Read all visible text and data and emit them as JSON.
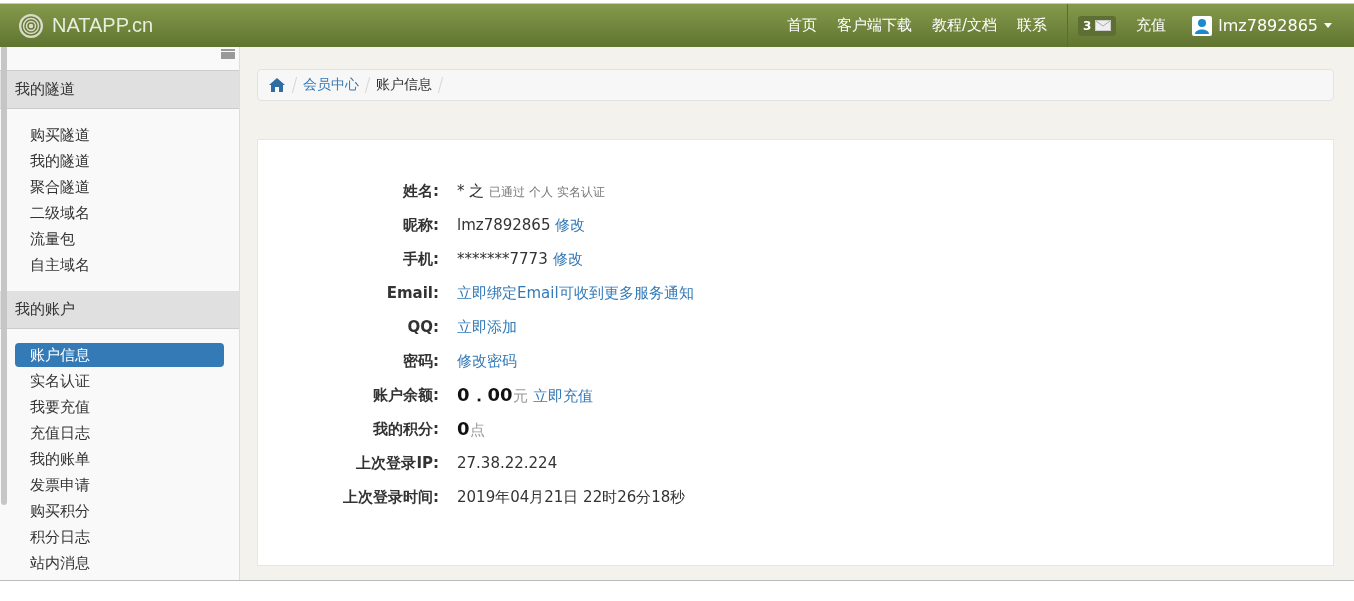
{
  "header": {
    "logo": "NATAPP.cn",
    "nav": [
      "首页",
      "客户端下载",
      "教程/文档",
      "联系"
    ],
    "message_count": "3",
    "recharge": "充值",
    "user": "lmz7892865"
  },
  "sidebar": {
    "sections": [
      {
        "title": "我的隧道",
        "items": [
          {
            "label": "购买隧道",
            "selected": false
          },
          {
            "label": "我的隧道",
            "selected": false
          },
          {
            "label": "聚合隧道",
            "selected": false
          },
          {
            "label": "二级域名",
            "selected": false
          },
          {
            "label": "流量包",
            "selected": false
          },
          {
            "label": "自主域名",
            "selected": false
          }
        ]
      },
      {
        "title": "我的账户",
        "items": [
          {
            "label": "账户信息",
            "selected": true
          },
          {
            "label": "实名认证",
            "selected": false
          },
          {
            "label": "我要充值",
            "selected": false
          },
          {
            "label": "充值日志",
            "selected": false
          },
          {
            "label": "我的账单",
            "selected": false
          },
          {
            "label": "发票申请",
            "selected": false
          },
          {
            "label": "购买积分",
            "selected": false
          },
          {
            "label": "积分日志",
            "selected": false
          },
          {
            "label": "站内消息",
            "selected": false
          }
        ]
      }
    ]
  },
  "breadcrumb": [
    {
      "label": "会员中心",
      "kind": "link"
    },
    {
      "label": "账户信息",
      "kind": "current"
    }
  ],
  "fields": [
    {
      "label": "姓名:",
      "parts": [
        {
          "kind": "text",
          "text": "* 之"
        },
        {
          "kind": "note",
          "text": "已通过 个人 实名认证"
        }
      ]
    },
    {
      "label": "昵称:",
      "parts": [
        {
          "kind": "text",
          "text": "lmz7892865"
        },
        {
          "kind": "link",
          "text": "修改"
        }
      ]
    },
    {
      "label": "手机:",
      "parts": [
        {
          "kind": "text",
          "text": "*******7773"
        },
        {
          "kind": "link",
          "text": "修改"
        }
      ]
    },
    {
      "label": "Email:",
      "parts": [
        {
          "kind": "link",
          "text": "立即绑定Email可收到更多服务通知"
        }
      ]
    },
    {
      "label": "QQ:",
      "parts": [
        {
          "kind": "link",
          "text": "立即添加"
        }
      ]
    },
    {
      "label": "密码:",
      "parts": [
        {
          "kind": "link",
          "text": "修改密码"
        }
      ]
    },
    {
      "label": "账户余额:",
      "parts": [
        {
          "kind": "amount",
          "text": "0．00"
        },
        {
          "kind": "unit",
          "text": "元"
        },
        {
          "kind": "link",
          "text": "立即充值"
        }
      ]
    },
    {
      "label": "我的积分:",
      "parts": [
        {
          "kind": "amount",
          "text": "0"
        },
        {
          "kind": "unit",
          "text": "点"
        }
      ]
    },
    {
      "label": "上次登录IP:",
      "parts": [
        {
          "kind": "text",
          "text": "27.38.22.224"
        }
      ]
    },
    {
      "label": "上次登录时间:",
      "parts": [
        {
          "kind": "text",
          "text": "2019年04月21日 22时26分18秒"
        }
      ]
    }
  ]
}
